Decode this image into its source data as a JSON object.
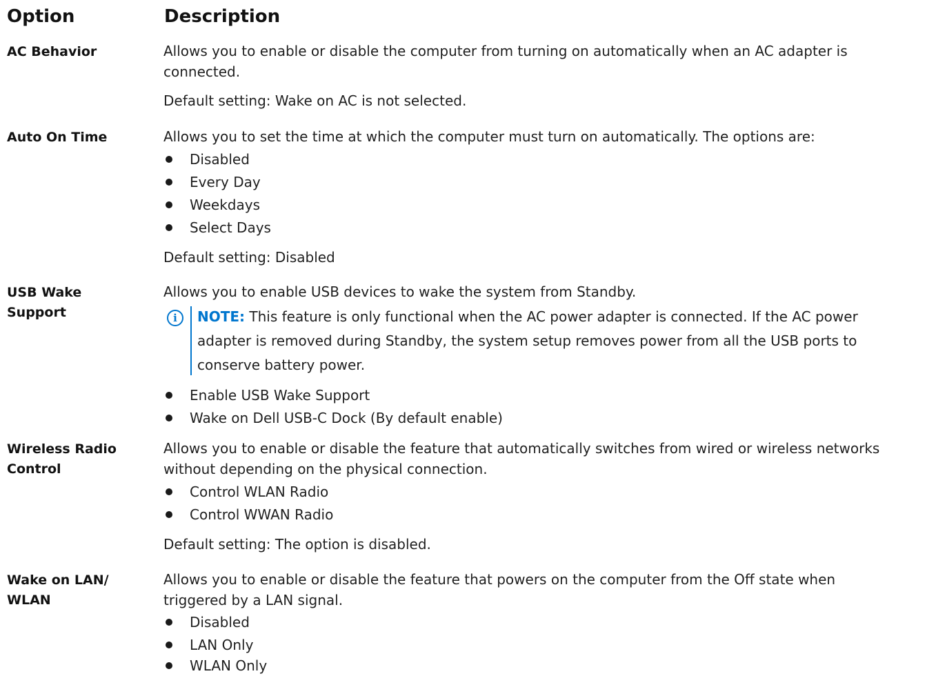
{
  "headers": {
    "option": "Option",
    "description": "Description"
  },
  "rows": {
    "ac_behavior": {
      "label": "AC Behavior",
      "desc_line1": "Allows you to enable or disable the computer from turning on automatically when an AC adapter is",
      "desc_line2": "connected.",
      "default": "Default setting: Wake on AC is not selected."
    },
    "auto_on_time": {
      "label": "Auto On Time",
      "desc": "Allows you to set the time at which the computer must turn on automatically. The options are:",
      "options": [
        "Disabled",
        "Every Day",
        "Weekdays",
        "Select Days"
      ],
      "default": "Default setting: Disabled"
    },
    "usb_wake": {
      "label_line1": "USB Wake",
      "label_line2": "Support",
      "desc": "Allows you to enable USB devices to wake the system from Standby.",
      "note_label": "NOTE:",
      "note_line1": " This feature is only functional when the AC power adapter is connected. If the AC power",
      "note_line2": "adapter is removed during Standby, the system setup removes power from all the USB ports to",
      "note_line3": "conserve battery power.",
      "options": [
        "Enable USB Wake Support",
        "Wake on Dell USB-C Dock (By default enable)"
      ]
    },
    "wireless_radio": {
      "label_line1": "Wireless Radio",
      "label_line2": "Control",
      "desc_line1": "Allows you to enable or disable the feature that automatically switches from wired or wireless networks",
      "desc_line2": "without depending on the physical connection.",
      "options": [
        "Control WLAN Radio",
        "Control WWAN Radio"
      ],
      "default": "Default setting: The option is disabled."
    },
    "wake_on_lan": {
      "label_line1": "Wake on LAN/",
      "label_line2": "WLAN",
      "desc_line1": "Allows you to enable or disable the feature that powers on the computer from the Off state when",
      "desc_line2": "triggered by a LAN signal.",
      "options": [
        "Disabled",
        "LAN Only",
        "WLAN Only"
      ]
    }
  }
}
